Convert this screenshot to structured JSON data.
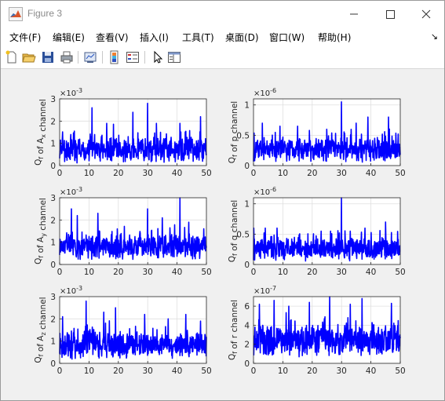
{
  "window": {
    "title": "Figure 3"
  },
  "menu": [
    "文件(F)",
    "编辑(E)",
    "查看(V)",
    "插入(I)",
    "工具(T)",
    "桌面(D)",
    "窗口(W)",
    "帮助(H)"
  ],
  "toolbar": [
    "new-figure-icon",
    "open-file-icon",
    "save-icon",
    "print-icon",
    "link-plot-icon",
    "colorbar-icon",
    "legend-icon",
    "pointer-icon",
    "property-editor-icon"
  ],
  "colors": {
    "line": "#0000ff",
    "axes_bg": "#ffffff",
    "figure_bg": "#f0f0f0",
    "grid": "#dfdfdf"
  },
  "chart_data": [
    {
      "type": "line",
      "ylabel": "Q_f of A_x channel",
      "exponent": "×10^-3",
      "xlim": [
        0,
        50
      ],
      "ylim": [
        0,
        3
      ],
      "xticks": [
        0,
        10,
        20,
        30,
        40,
        50
      ],
      "yticks": [
        0,
        1,
        2,
        3
      ],
      "grid": true,
      "series": [
        {
          "x_range": [
            0,
            50
          ],
          "baseline": 0.7,
          "spread": 0.45,
          "noise_floor": 0.15,
          "peaks": [
            [
              11,
              2.6
            ],
            [
              16,
              1.9
            ],
            [
              25,
              2.4
            ],
            [
              30,
              2.8
            ],
            [
              33,
              1.9
            ],
            [
              41,
              1.9
            ],
            [
              48,
              2.2
            ]
          ]
        }
      ]
    },
    {
      "type": "line",
      "ylabel": "Q_f of p channel",
      "exponent": "×10^-6",
      "xlim": [
        0,
        50
      ],
      "ylim": [
        0,
        1.1
      ],
      "xticks": [
        0,
        10,
        20,
        30,
        40,
        50
      ],
      "yticks": [
        0,
        0.5,
        1
      ],
      "grid": true,
      "series": [
        {
          "x_range": [
            0,
            50
          ],
          "baseline": 0.25,
          "spread": 0.15,
          "noise_floor": 0.05,
          "peaks": [
            [
              3,
              0.7
            ],
            [
              9,
              0.65
            ],
            [
              15,
              0.65
            ],
            [
              25,
              0.6
            ],
            [
              30,
              1.05
            ],
            [
              35,
              0.7
            ],
            [
              39,
              0.8
            ],
            [
              46,
              0.8
            ]
          ]
        }
      ]
    },
    {
      "type": "line",
      "ylabel": "Q_f of A_y channel",
      "exponent": "×10^-3",
      "xlim": [
        0,
        50
      ],
      "ylim": [
        0,
        3
      ],
      "xticks": [
        0,
        10,
        20,
        30,
        40,
        50
      ],
      "yticks": [
        0,
        1,
        2,
        3
      ],
      "grid": true,
      "series": [
        {
          "x_range": [
            0,
            50
          ],
          "baseline": 0.8,
          "spread": 0.45,
          "noise_floor": 0.15,
          "peaks": [
            [
              4,
              2.5
            ],
            [
              6,
              2.2
            ],
            [
              13,
              2.3
            ],
            [
              30,
              2.5
            ],
            [
              35,
              2.1
            ],
            [
              41,
              3.0
            ],
            [
              44,
              1.9
            ]
          ]
        }
      ]
    },
    {
      "type": "line",
      "ylabel": "Q_f of q channel",
      "exponent": "×10^-6",
      "xlim": [
        0,
        50
      ],
      "ylim": [
        0,
        1.1
      ],
      "xticks": [
        0,
        10,
        20,
        30,
        40,
        50
      ],
      "yticks": [
        0,
        0.5,
        1
      ],
      "grid": true,
      "series": [
        {
          "x_range": [
            0,
            50
          ],
          "baseline": 0.25,
          "spread": 0.15,
          "noise_floor": 0.05,
          "peaks": [
            [
              4,
              0.6
            ],
            [
              8,
              0.6
            ],
            [
              23,
              0.55
            ],
            [
              30,
              1.1
            ],
            [
              33,
              0.55
            ],
            [
              38,
              0.6
            ],
            [
              45,
              0.7
            ]
          ]
        }
      ]
    },
    {
      "type": "line",
      "ylabel": "Q_f of A_z channel",
      "exponent": "×10^-3",
      "xlim": [
        0,
        50
      ],
      "ylim": [
        0,
        3
      ],
      "xticks": [
        0,
        10,
        20,
        30,
        40,
        50
      ],
      "yticks": [
        0,
        1,
        2,
        3
      ],
      "grid": true,
      "series": [
        {
          "x_range": [
            0,
            50
          ],
          "baseline": 0.8,
          "spread": 0.45,
          "noise_floor": 0.15,
          "peaks": [
            [
              1,
              2.1
            ],
            [
              9,
              2.8
            ],
            [
              15,
              2.3
            ],
            [
              19,
              2.5
            ],
            [
              29,
              2.2
            ],
            [
              37,
              2.0
            ],
            [
              43,
              2.2
            ],
            [
              48,
              1.9
            ]
          ]
        }
      ]
    },
    {
      "type": "line",
      "ylabel": "Q_f of r channel",
      "exponent": "×10^-7",
      "xlim": [
        0,
        50
      ],
      "ylim": [
        0,
        7
      ],
      "xticks": [
        0,
        10,
        20,
        30,
        40,
        50
      ],
      "yticks": [
        0,
        2,
        4,
        6
      ],
      "grid": true,
      "series": [
        {
          "x_range": [
            0,
            50
          ],
          "baseline": 2.4,
          "spread": 1.3,
          "noise_floor": 0.6,
          "peaks": [
            [
              2,
              6.2
            ],
            [
              7,
              6.6
            ],
            [
              12,
              6.0
            ],
            [
              19,
              6.4
            ],
            [
              26,
              7.0
            ],
            [
              33,
              6.2
            ],
            [
              37,
              6.8
            ],
            [
              47,
              6.3
            ]
          ]
        }
      ]
    }
  ]
}
